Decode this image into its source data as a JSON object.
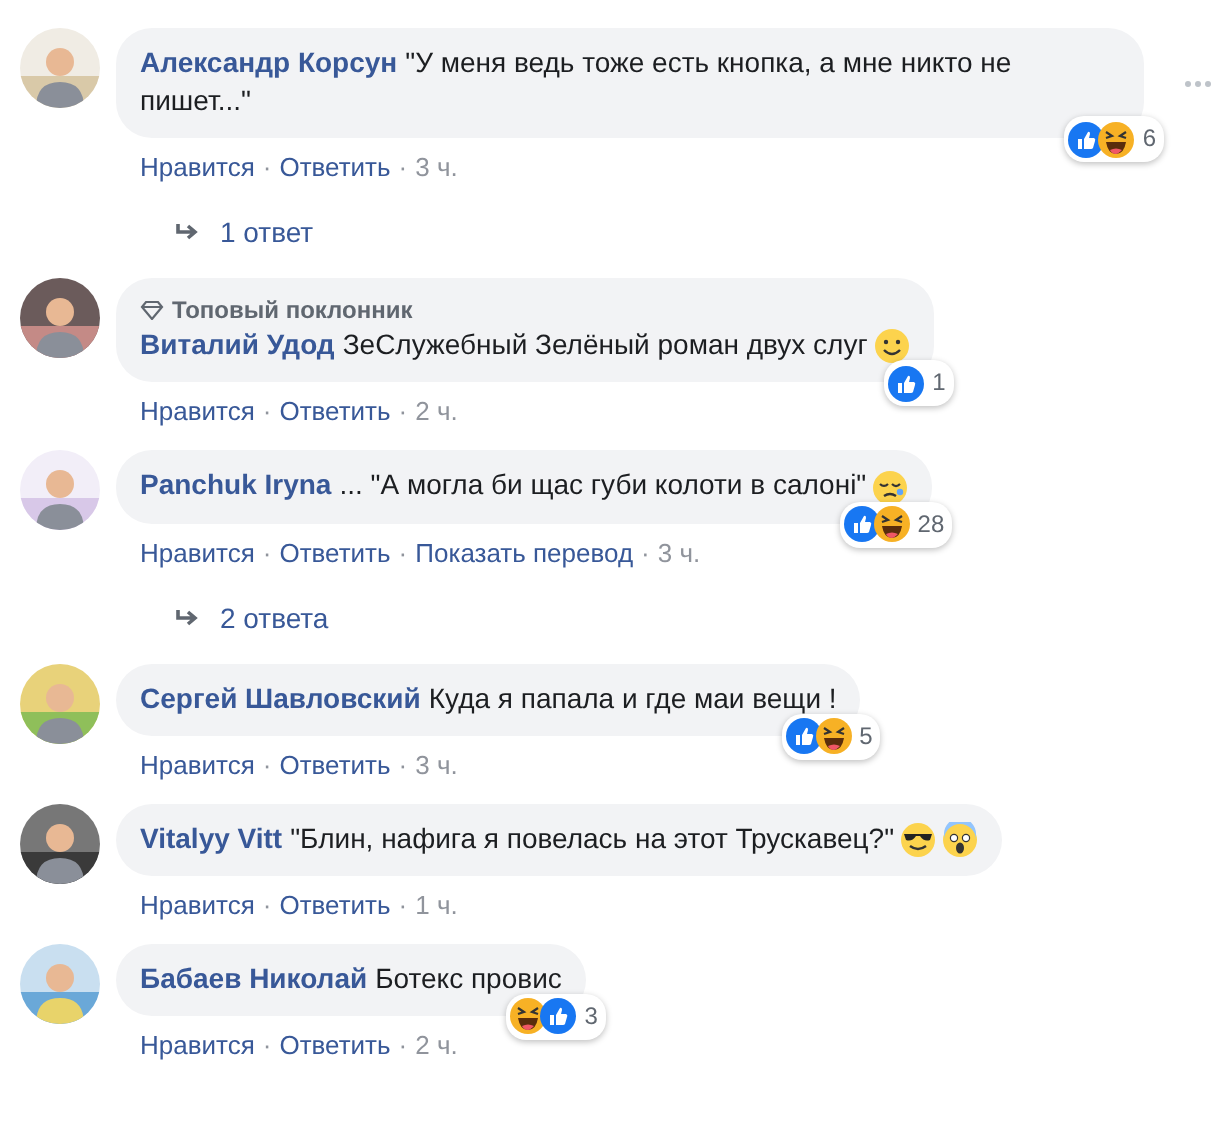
{
  "separator": "·",
  "comments": [
    {
      "author": "Александр Корсун",
      "text": "\"У меня ведь тоже есть кнопка, а мне никто не пишет...\"",
      "reactions": [
        {
          "kind": "like"
        },
        {
          "kind": "haha"
        }
      ],
      "count": "6",
      "actions": [
        "Нравится",
        "Ответить"
      ],
      "time": "3 ч.",
      "more": true,
      "replies": "1 ответ"
    },
    {
      "badge": "Топовый поклонник",
      "author": "Виталий Удод",
      "text": "ЗеСлужебный Зелёный роман двух слуг",
      "emoji": [
        {
          "kind": "smile"
        }
      ],
      "reactions": [
        {
          "kind": "like"
        }
      ],
      "count": "1",
      "actions": [
        "Нравится",
        "Ответить"
      ],
      "time": "2 ч."
    },
    {
      "author": "Panchuk Iryna",
      "text": "... \"А могла би щас губи колоти в салоні\"",
      "emoji": [
        {
          "kind": "sleepy"
        }
      ],
      "reactions": [
        {
          "kind": "like"
        },
        {
          "kind": "haha"
        }
      ],
      "count": "28",
      "actions": [
        "Нравится",
        "Ответить",
        "Показать перевод"
      ],
      "time": "3 ч.",
      "replies": "2 ответа"
    },
    {
      "author": "Сергей Шавловский",
      "text": "Куда я папала и где маи вещи !",
      "reactions": [
        {
          "kind": "like"
        },
        {
          "kind": "haha"
        }
      ],
      "count": "5",
      "actions": [
        "Нравится",
        "Ответить"
      ],
      "time": "3 ч."
    },
    {
      "author": "Vitalyy Vitt",
      "text": "\"Блин, нафига я повелась на этот Трускавец?\"",
      "emoji": [
        {
          "kind": "cool"
        },
        {
          "kind": "scream"
        }
      ],
      "actions": [
        "Нравится",
        "Ответить"
      ],
      "time": "1 ч."
    },
    {
      "author": "Бабаев Николай",
      "text": "Ботекс провис",
      "reactions": [
        {
          "kind": "haha"
        },
        {
          "kind": "like"
        }
      ],
      "count": "3",
      "actions": [
        "Нравится",
        "Ответить"
      ],
      "time": "2 ч."
    }
  ]
}
